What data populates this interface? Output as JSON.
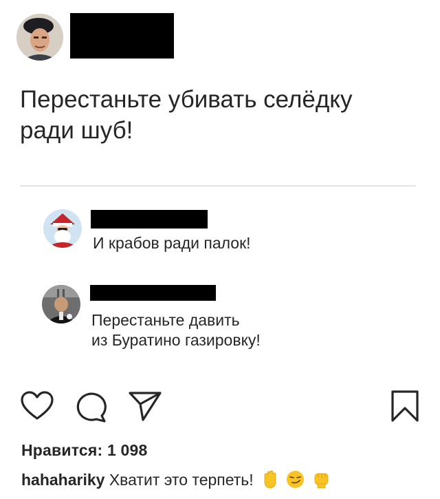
{
  "post": {
    "text_line1": "Перестаньте убивать селёдку",
    "text_line2": "ради шуб!",
    "replies": [
      {
        "text_lines": [
          "И крабов ради палок!"
        ]
      },
      {
        "text_lines": [
          "Перестаньте давить",
          "из Буратино газировку!"
        ]
      }
    ]
  },
  "actions": {
    "like_icon": "heart-outline-icon",
    "comment_icon": "comment-bubble-icon",
    "share_icon": "paper-plane-icon",
    "save_icon": "bookmark-icon"
  },
  "likes": {
    "text": "Нравится: 1 098"
  },
  "caption": {
    "username": "hahahariky",
    "text": "Хватит это терпеть!",
    "emojis": [
      "raised-hand-emoji",
      "smirking-face-emoji",
      "raised-fist-emoji"
    ]
  },
  "colors": {
    "text": "#262626",
    "redaction": "#000000",
    "divider": "#e3e3e3",
    "emoji_yellow": "#f7c325"
  }
}
